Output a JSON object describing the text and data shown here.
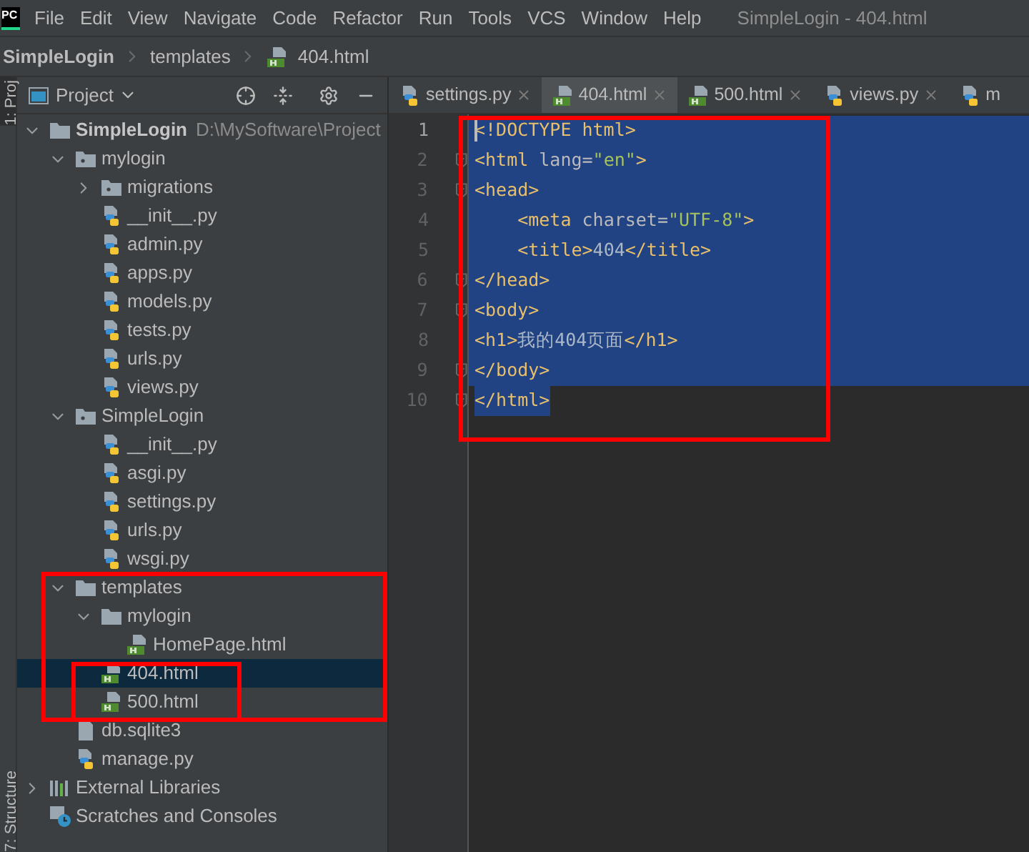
{
  "app_logo": "PC",
  "menu": [
    "File",
    "Edit",
    "View",
    "Navigate",
    "Code",
    "Refactor",
    "Run",
    "Tools",
    "VCS",
    "Window",
    "Help"
  ],
  "window": {
    "title": "SimpleLogin - 404.html"
  },
  "breadcrumb": [
    {
      "label": "SimpleLogin",
      "kind": "project"
    },
    {
      "label": "templates",
      "kind": "folder"
    },
    {
      "label": "404.html",
      "kind": "html"
    }
  ],
  "tool_strip": {
    "top": "1: Proj",
    "bottom": "7: Structure"
  },
  "project_panel": {
    "title": "Project",
    "tree": [
      {
        "label": "SimpleLogin",
        "kind": "root",
        "path": "D:\\MySoftware\\Project",
        "expanded": true,
        "selected": false,
        "children": [
          {
            "label": "mylogin",
            "kind": "package",
            "expanded": true,
            "selected": false,
            "children": [
              {
                "label": "migrations",
                "kind": "package",
                "expanded": false,
                "selected": false
              },
              {
                "label": "__init__.py",
                "kind": "python",
                "selected": false
              },
              {
                "label": "admin.py",
                "kind": "python",
                "selected": false
              },
              {
                "label": "apps.py",
                "kind": "python",
                "selected": false
              },
              {
                "label": "models.py",
                "kind": "python",
                "selected": false
              },
              {
                "label": "tests.py",
                "kind": "python",
                "selected": false
              },
              {
                "label": "urls.py",
                "kind": "python",
                "selected": false
              },
              {
                "label": "views.py",
                "kind": "python",
                "selected": false
              }
            ]
          },
          {
            "label": "SimpleLogin",
            "kind": "package",
            "expanded": true,
            "selected": false,
            "children": [
              {
                "label": "__init__.py",
                "kind": "python",
                "selected": false
              },
              {
                "label": "asgi.py",
                "kind": "python",
                "selected": false
              },
              {
                "label": "settings.py",
                "kind": "python",
                "selected": false
              },
              {
                "label": "urls.py",
                "kind": "python",
                "selected": false
              },
              {
                "label": "wsgi.py",
                "kind": "python",
                "selected": false
              }
            ]
          },
          {
            "label": "templates",
            "kind": "folder",
            "expanded": true,
            "selected": false,
            "children": [
              {
                "label": "mylogin",
                "kind": "folder",
                "expanded": true,
                "selected": false,
                "children": [
                  {
                    "label": "HomePage.html",
                    "kind": "html",
                    "selected": false
                  }
                ]
              },
              {
                "label": "404.html",
                "kind": "html",
                "selected": true
              },
              {
                "label": "500.html",
                "kind": "html",
                "selected": false
              }
            ]
          },
          {
            "label": "db.sqlite3",
            "kind": "file",
            "selected": false
          },
          {
            "label": "manage.py",
            "kind": "python",
            "selected": false
          }
        ]
      },
      {
        "label": "External Libraries",
        "kind": "libraries",
        "expanded": false,
        "selected": false
      },
      {
        "label": "Scratches and Consoles",
        "kind": "scratches",
        "selected": false
      }
    ]
  },
  "tabs": [
    {
      "label": "settings.py",
      "kind": "python",
      "selected": false,
      "closable": true
    },
    {
      "label": "404.html",
      "kind": "html",
      "selected": true,
      "closable": true
    },
    {
      "label": "500.html",
      "kind": "html",
      "selected": false,
      "closable": true
    },
    {
      "label": "views.py",
      "kind": "python",
      "selected": false,
      "closable": true
    },
    {
      "label": "m",
      "kind": "python",
      "selected": false,
      "closable": false
    }
  ],
  "editor": {
    "lines": [
      {
        "number": "1",
        "selected": true,
        "full_width": true,
        "fold": false,
        "caret": true,
        "tokens": [
          {
            "text": "<!DOCTYPE html>",
            "kind": "tag"
          }
        ]
      },
      {
        "number": "2",
        "selected": true,
        "full_width": true,
        "fold": true,
        "caret": false,
        "tokens": [
          {
            "text": "<html ",
            "kind": "tag"
          },
          {
            "text": "lang=",
            "kind": "attr"
          },
          {
            "text": "\"en\"",
            "kind": "string"
          },
          {
            "text": ">",
            "kind": "tag"
          }
        ]
      },
      {
        "number": "3",
        "selected": true,
        "full_width": true,
        "fold": true,
        "caret": false,
        "tokens": [
          {
            "text": "<head>",
            "kind": "tag"
          }
        ]
      },
      {
        "number": "4",
        "selected": true,
        "full_width": true,
        "fold": false,
        "caret": false,
        "tokens": [
          {
            "text": "    <meta ",
            "kind": "tag"
          },
          {
            "text": "charset=",
            "kind": "attr"
          },
          {
            "text": "\"UTF-8\"",
            "kind": "string"
          },
          {
            "text": ">",
            "kind": "tag"
          }
        ]
      },
      {
        "number": "5",
        "selected": true,
        "full_width": true,
        "fold": false,
        "caret": false,
        "tokens": [
          {
            "text": "    <title>",
            "kind": "tag"
          },
          {
            "text": "404",
            "kind": "text"
          },
          {
            "text": "</title>",
            "kind": "tag"
          }
        ]
      },
      {
        "number": "6",
        "selected": true,
        "full_width": true,
        "fold": true,
        "caret": false,
        "tokens": [
          {
            "text": "</head>",
            "kind": "tag"
          }
        ]
      },
      {
        "number": "7",
        "selected": true,
        "full_width": true,
        "fold": true,
        "caret": false,
        "tokens": [
          {
            "text": "<body>",
            "kind": "tag"
          }
        ]
      },
      {
        "number": "8",
        "selected": true,
        "full_width": true,
        "fold": false,
        "caret": false,
        "tokens": [
          {
            "text": "<h1>",
            "kind": "tag"
          },
          {
            "text": "我的404页面",
            "kind": "text"
          },
          {
            "text": "</h1>",
            "kind": "tag"
          }
        ]
      },
      {
        "number": "9",
        "selected": true,
        "full_width": true,
        "fold": true,
        "caret": false,
        "tokens": [
          {
            "text": "</body>",
            "kind": "tag"
          }
        ]
      },
      {
        "number": "10",
        "selected": true,
        "full_width": false,
        "fold": true,
        "caret": false,
        "tokens": [
          {
            "text": "</html>",
            "kind": "tag"
          }
        ]
      }
    ]
  }
}
